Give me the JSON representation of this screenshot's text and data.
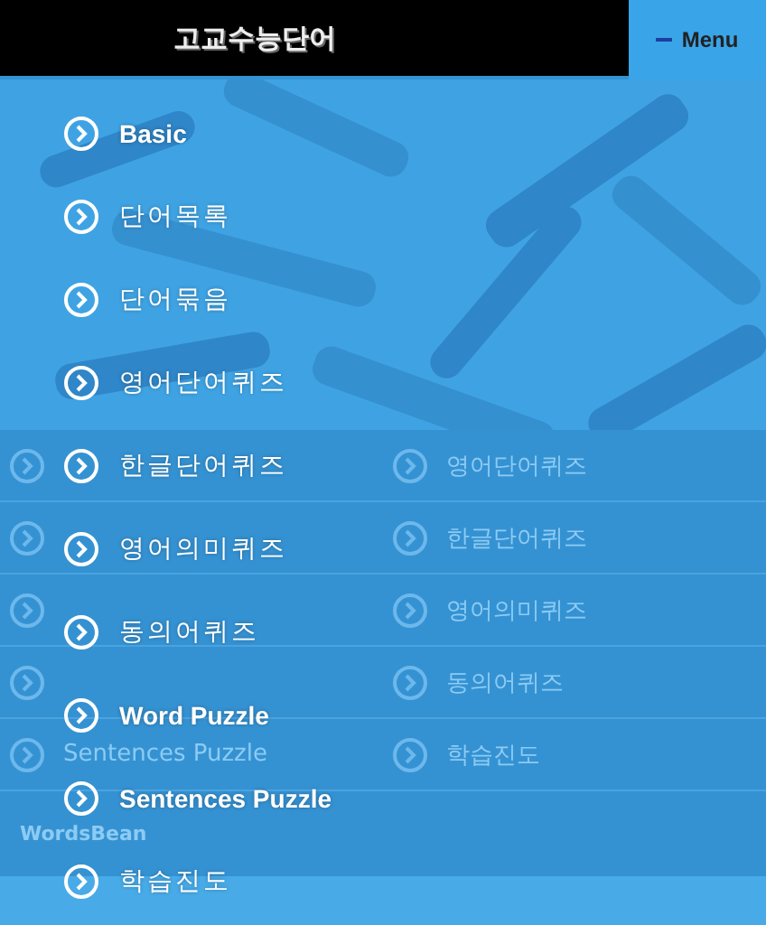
{
  "header": {
    "title": "고교수능단어",
    "menu_button": "Menu"
  },
  "page": {
    "grid": [
      {
        "right": "영어단어퀴즈"
      },
      {
        "right": "한글단어퀴즈"
      },
      {
        "right": "영어의미퀴즈"
      },
      {
        "right": "동의어퀴즈"
      },
      {
        "left": "Sentences Puzzle",
        "right": "학습진도"
      }
    ],
    "footer": "WordsBean"
  },
  "menu": [
    {
      "label": "Basic",
      "bold": true
    },
    {
      "label": "단어목록",
      "bold": false
    },
    {
      "label": "단어묶음",
      "bold": false
    },
    {
      "label": "영어단어퀴즈",
      "bold": false
    },
    {
      "label": "한글단어퀴즈",
      "bold": false
    },
    {
      "label": "영어의미퀴즈",
      "bold": false
    },
    {
      "label": "동의어퀴즈",
      "bold": false
    },
    {
      "label": "Word Puzzle",
      "bold": true
    },
    {
      "label": "Sentences Puzzle",
      "bold": true
    },
    {
      "label": "학습진도",
      "bold": false
    }
  ]
}
